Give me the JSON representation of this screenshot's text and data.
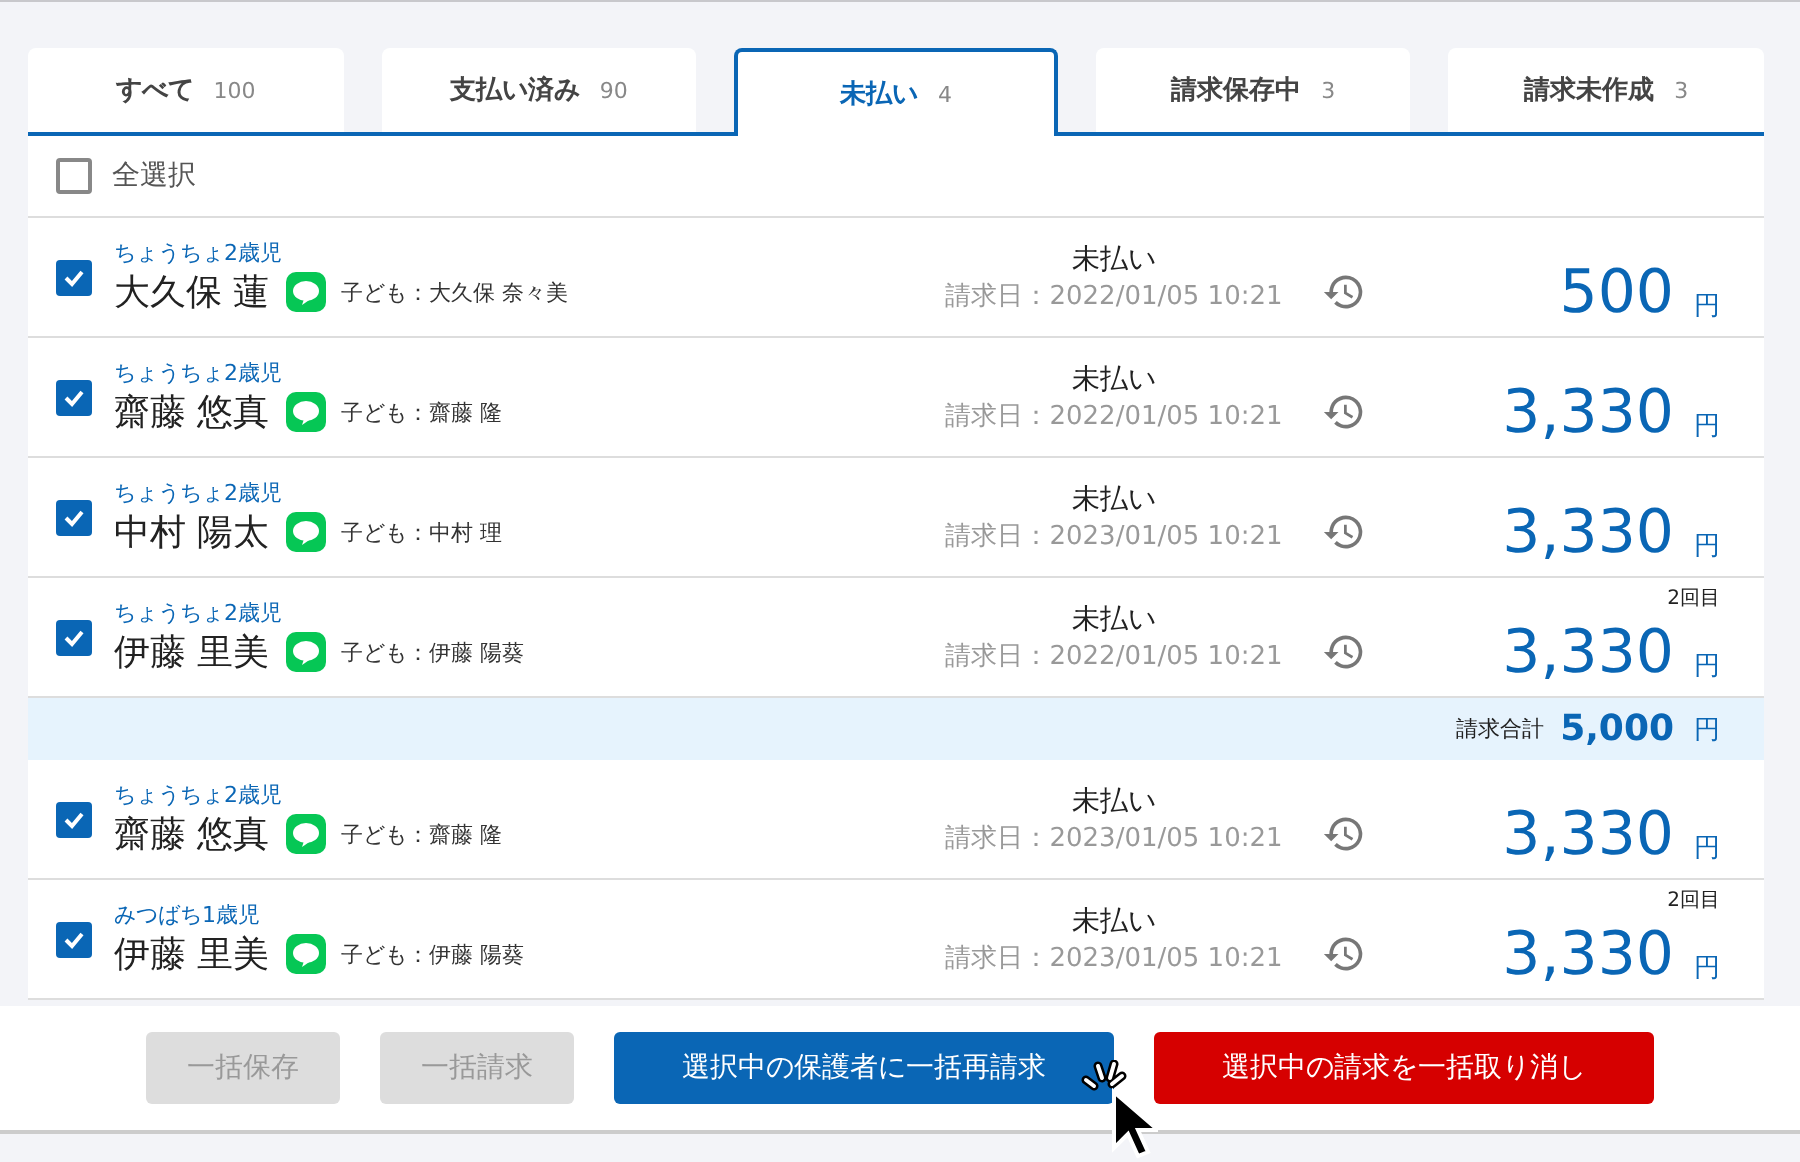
{
  "tabs": [
    {
      "label": "すべて",
      "count": "100",
      "selected": false
    },
    {
      "label": "支払い済み",
      "count": "90",
      "selected": false
    },
    {
      "label": "未払い",
      "count": "4",
      "selected": true
    },
    {
      "label": "請求保存中",
      "count": "3",
      "selected": false
    },
    {
      "label": "請求未作成",
      "count": "3",
      "selected": false
    }
  ],
  "select_all": {
    "label": "全選択",
    "checked": false
  },
  "rows": [
    {
      "kind": "invoice",
      "checked": true,
      "class": "ちょうちょ2歳児",
      "name": "大久保 蓮",
      "child": "子ども：大久保 奈々美",
      "status": "未払い",
      "date": "請求日：2022/01/05 10:21",
      "amount": "500",
      "unit": "円"
    },
    {
      "kind": "invoice",
      "checked": true,
      "class": "ちょうちょ2歳児",
      "name": "齋藤 悠真",
      "child": "子ども：齋藤 隆",
      "status": "未払い",
      "date": "請求日：2022/01/05 10:21",
      "amount": "3,330",
      "unit": "円"
    },
    {
      "kind": "invoice",
      "checked": true,
      "class": "ちょうちょ2歳児",
      "name": "中村 陽太",
      "child": "子ども：中村 理",
      "status": "未払い",
      "date": "請求日：2023/01/05 10:21",
      "amount": "3,330",
      "unit": "円"
    },
    {
      "kind": "invoice",
      "checked": true,
      "class": "ちょうちょ2歳児",
      "name": "伊藤 里美",
      "child": "子ども：伊藤 陽葵",
      "status": "未払い",
      "date": "請求日：2022/01/05 10:21",
      "amount": "3,330",
      "unit": "円",
      "round": "2回目"
    },
    {
      "kind": "total",
      "label": "請求合計",
      "amount": "5,000",
      "unit": "円"
    },
    {
      "kind": "invoice",
      "checked": true,
      "class": "ちょうちょ2歳児",
      "name": "齋藤 悠真",
      "child": "子ども：齋藤 隆",
      "status": "未払い",
      "date": "請求日：2023/01/05 10:21",
      "amount": "3,330",
      "unit": "円"
    },
    {
      "kind": "invoice",
      "checked": true,
      "class": "みつばち1歳児",
      "name": "伊藤 里美",
      "child": "子ども：伊藤 陽葵",
      "status": "未払い",
      "date": "請求日：2023/01/05 10:21",
      "amount": "3,330",
      "unit": "円",
      "round": "2回目"
    }
  ],
  "buttons": [
    {
      "label": "一括保存",
      "kind": "neutral",
      "disabled": true
    },
    {
      "label": "一括請求",
      "kind": "neutral",
      "disabled": true
    },
    {
      "label": "選択中の保護者に一括再請求",
      "kind": "primary",
      "disabled": false,
      "cursor": true
    },
    {
      "label": "選択中の請求を一括取り消し",
      "kind": "danger",
      "disabled": false
    }
  ]
}
